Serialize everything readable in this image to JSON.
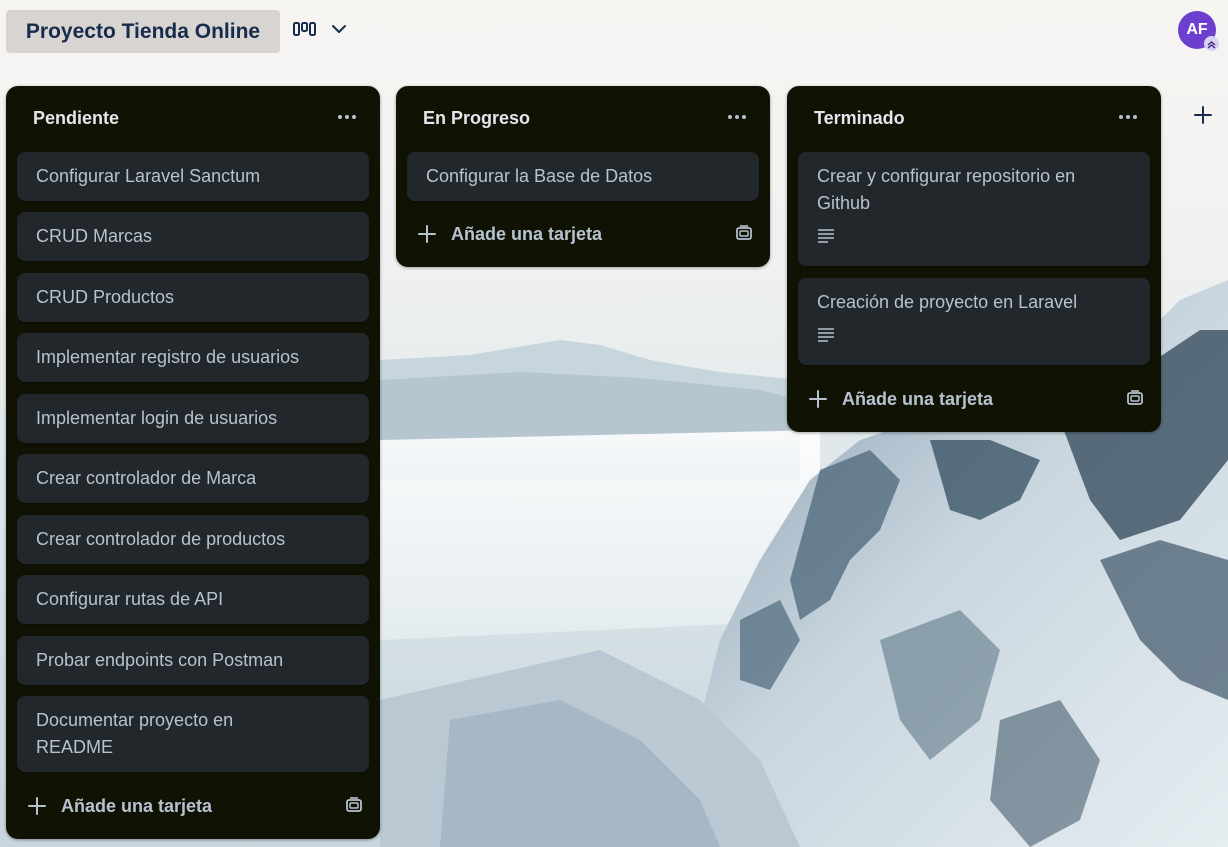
{
  "board": {
    "title": "Proyecto Tienda Online",
    "avatar_initials": "AF",
    "accent_color": "#6c3fcf"
  },
  "lists": [
    {
      "title": "Pendiente",
      "cards": [
        {
          "text": "Configurar Laravel Sanctum"
        },
        {
          "text": "CRUD Marcas"
        },
        {
          "text": "CRUD Productos"
        },
        {
          "text": "Implementar registro de usuarios"
        },
        {
          "text": "Implementar login de usuarios"
        },
        {
          "text": "Crear controlador de Marca"
        },
        {
          "text": "Crear controlador de productos"
        },
        {
          "text": "Configurar rutas de API"
        },
        {
          "text": "Probar endpoints con Postman"
        },
        {
          "text": "Documentar proyecto en README"
        }
      ],
      "add_label": "Añade una tarjeta"
    },
    {
      "title": "En Progreso",
      "cards": [
        {
          "text": "Configurar la Base de Datos"
        }
      ],
      "add_label": "Añade una tarjeta"
    },
    {
      "title": "Terminado",
      "cards": [
        {
          "text": "Crear y configurar repositorio en Github",
          "has_description": true
        },
        {
          "text": "Creación de proyecto en Laravel",
          "has_description": true
        }
      ],
      "add_label": "Añade una tarjeta"
    }
  ],
  "icons": {
    "view_switch": "board-view-icon",
    "view_dropdown": "chevron-down-icon",
    "list_menu": "more-horizontal-icon",
    "add": "plus-icon",
    "template": "card-template-icon",
    "description": "description-lines-icon"
  }
}
